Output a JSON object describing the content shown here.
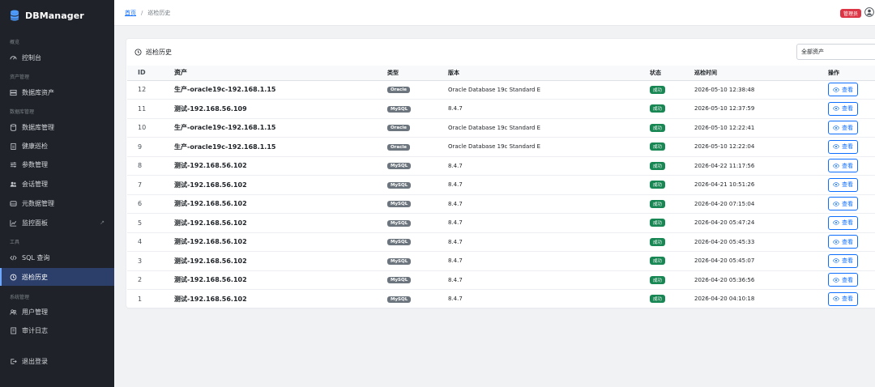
{
  "app": {
    "title": "DBManager"
  },
  "sidebar": {
    "sections": [
      {
        "label": "概览"
      },
      {
        "label": "资产管理"
      },
      {
        "label": "数据库管理"
      },
      {
        "label": "工具"
      },
      {
        "label": "系统管理"
      }
    ],
    "items": [
      {
        "label": "控制台",
        "icon": "speedometer-icon"
      },
      {
        "label": "数据库资产",
        "icon": "server-icon"
      },
      {
        "label": "数据库管理",
        "icon": "database-icon"
      },
      {
        "label": "健康巡检",
        "icon": "clipboard-icon"
      },
      {
        "label": "参数管理",
        "icon": "sliders-icon"
      },
      {
        "label": "会话管理",
        "icon": "people-icon"
      },
      {
        "label": "元数据管理",
        "icon": "hdd-icon"
      },
      {
        "label": "监控面板",
        "icon": "graph-icon"
      },
      {
        "label": "SQL 查询",
        "icon": "code-icon"
      },
      {
        "label": "巡检历史",
        "icon": "clock-history-icon",
        "active": true
      },
      {
        "label": "用户管理",
        "icon": "people-icon"
      },
      {
        "label": "审计日志",
        "icon": "journal-icon"
      },
      {
        "label": "退出登录",
        "icon": "logout-icon"
      }
    ]
  },
  "header": {
    "breadcrumb_home": "首页",
    "breadcrumb_sep": "/",
    "breadcrumb_current": "巡检历史",
    "role_badge": "管理员"
  },
  "card": {
    "title": "巡检历史",
    "filter_value": "全部资产"
  },
  "table": {
    "columns": [
      "ID",
      "资产",
      "类型",
      "版本",
      "状态",
      "巡检时间",
      "操作"
    ],
    "view_label": "查看",
    "rows": [
      {
        "id": "12",
        "asset": "生产-oracle19c-192.168.1.15",
        "type": "Oracle",
        "version": "Oracle Database 19c Standard E",
        "status": "成功",
        "time": "2026-05-10 12:38:48"
      },
      {
        "id": "11",
        "asset": "测试-192.168.56.109",
        "type": "MySQL",
        "version": "8.4.7",
        "status": "成功",
        "time": "2026-05-10 12:37:59"
      },
      {
        "id": "10",
        "asset": "生产-oracle19c-192.168.1.15",
        "type": "Oracle",
        "version": "Oracle Database 19c Standard E",
        "status": "成功",
        "time": "2026-05-10 12:22:41"
      },
      {
        "id": "9",
        "asset": "生产-oracle19c-192.168.1.15",
        "type": "Oracle",
        "version": "Oracle Database 19c Standard E",
        "status": "成功",
        "time": "2026-05-10 12:22:04"
      },
      {
        "id": "8",
        "asset": "测试-192.168.56.102",
        "type": "MySQL",
        "version": "8.4.7",
        "status": "成功",
        "time": "2026-04-22 11:17:56"
      },
      {
        "id": "7",
        "asset": "测试-192.168.56.102",
        "type": "MySQL",
        "version": "8.4.7",
        "status": "成功",
        "time": "2026-04-21 10:51:26"
      },
      {
        "id": "6",
        "asset": "测试-192.168.56.102",
        "type": "MySQL",
        "version": "8.4.7",
        "status": "成功",
        "time": "2026-04-20 07:15:04"
      },
      {
        "id": "5",
        "asset": "测试-192.168.56.102",
        "type": "MySQL",
        "version": "8.4.7",
        "status": "成功",
        "time": "2026-04-20 05:47:24"
      },
      {
        "id": "4",
        "asset": "测试-192.168.56.102",
        "type": "MySQL",
        "version": "8.4.7",
        "status": "成功",
        "time": "2026-04-20 05:45:33"
      },
      {
        "id": "3",
        "asset": "测试-192.168.56.102",
        "type": "MySQL",
        "version": "8.4.7",
        "status": "成功",
        "time": "2026-04-20 05:45:07"
      },
      {
        "id": "2",
        "asset": "测试-192.168.56.102",
        "type": "MySQL",
        "version": "8.4.7",
        "status": "成功",
        "time": "2026-04-20 05:36:56"
      },
      {
        "id": "1",
        "asset": "测试-192.168.56.102",
        "type": "MySQL",
        "version": "8.4.7",
        "status": "成功",
        "time": "2026-04-20 04:10:18"
      }
    ]
  },
  "colors": {
    "sidebar_bg": "#1f2329",
    "active_bg": "#2c3f6a",
    "primary": "#0d6efd",
    "success": "#198754",
    "danger": "#dc3545",
    "type_badge": "#6c757d"
  }
}
